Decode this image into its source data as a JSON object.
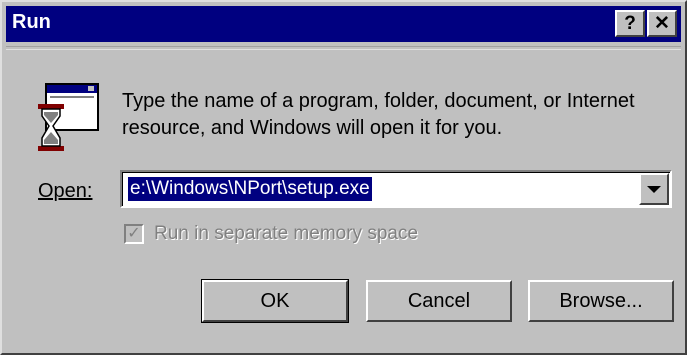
{
  "window": {
    "title": "Run",
    "help_button": "?",
    "close_button": "✕"
  },
  "description": "Type the name of a program, folder, document, or Internet resource, and Windows will open it for you.",
  "open_field": {
    "label": "Open:",
    "value": "e:\\Windows\\NPort\\setup.exe"
  },
  "checkbox": {
    "label": "Run in separate memory space",
    "checked": true,
    "disabled": true,
    "mark": "✓"
  },
  "buttons": {
    "ok": "OK",
    "cancel": "Cancel",
    "browse": "Browse..."
  },
  "colors": {
    "title_bar": "#000080",
    "face": "#c0c0c0",
    "selection": "#000080"
  }
}
